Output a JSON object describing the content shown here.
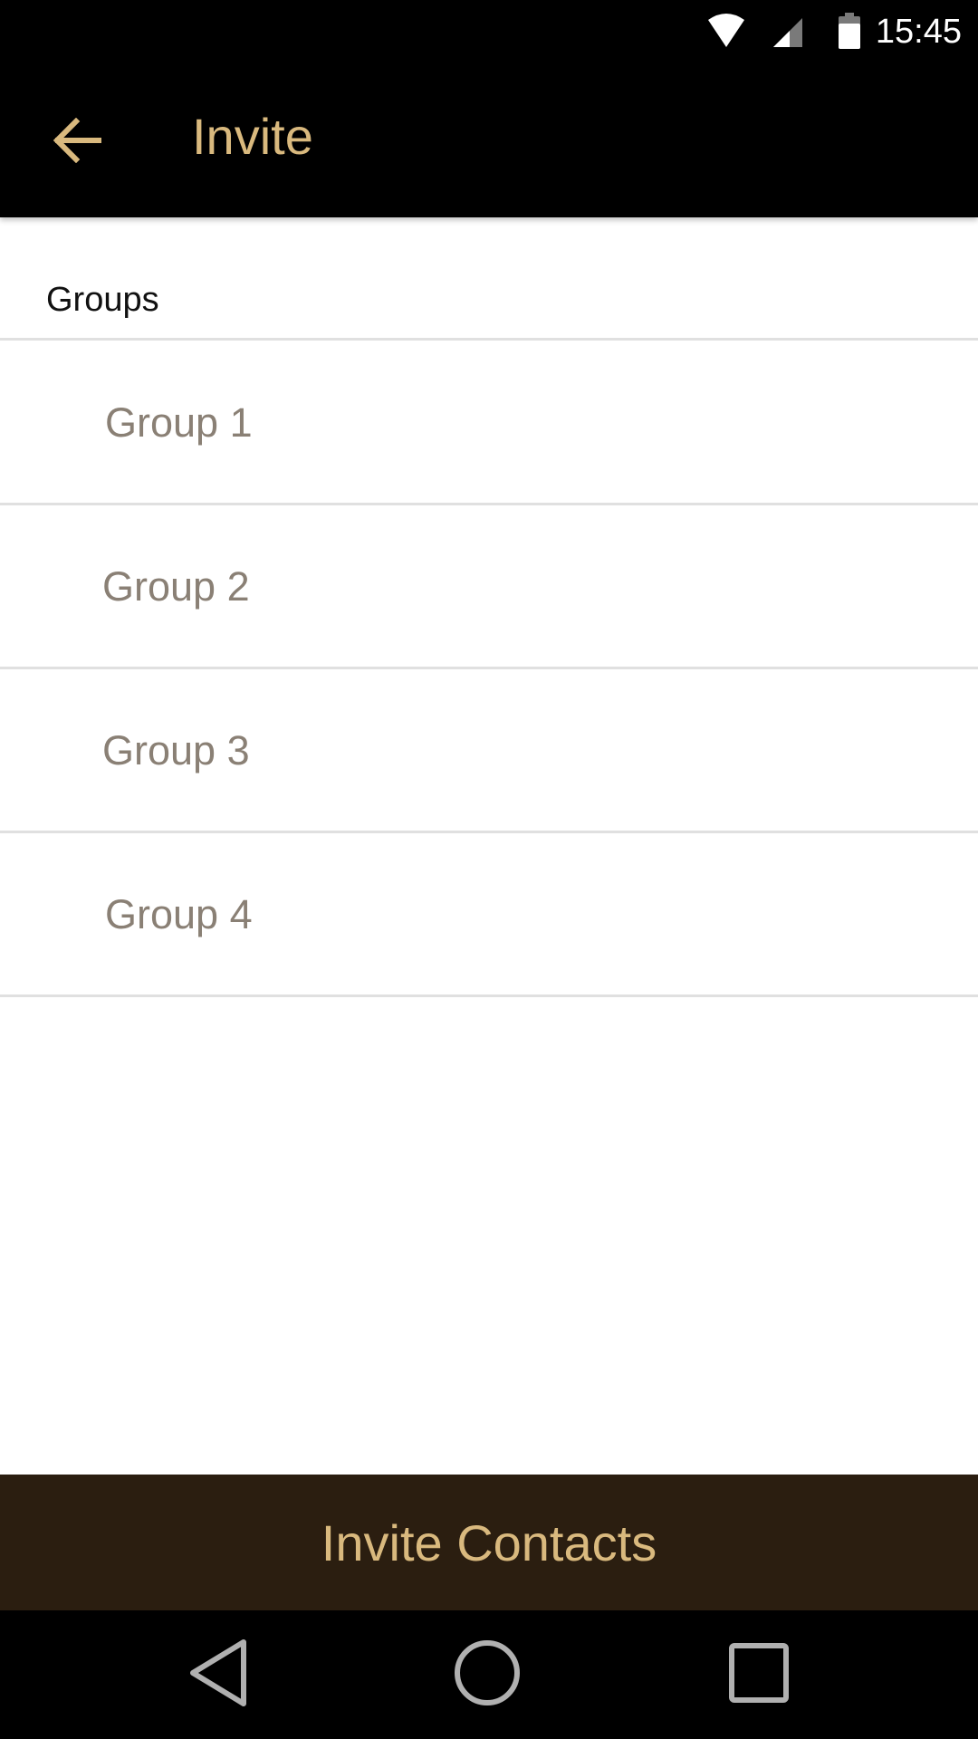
{
  "status_bar": {
    "time": "15:45",
    "icons": [
      "wifi-icon",
      "cell-signal-icon",
      "battery-icon"
    ]
  },
  "app_bar": {
    "title": "Invite",
    "back_icon": "arrow-left-icon"
  },
  "section": {
    "header": "Groups"
  },
  "groups": [
    {
      "label": "Group 1"
    },
    {
      "label": "Group 2"
    },
    {
      "label": "Group 3"
    },
    {
      "label": "Group 4"
    }
  ],
  "invite_button": {
    "label": "Invite Contacts"
  },
  "nav_bar": {
    "icons": [
      "nav-back-icon",
      "nav-home-icon",
      "nav-recents-icon"
    ]
  },
  "colors": {
    "accent": "#d9b97e",
    "app_bar": "#000000",
    "button_bg": "#2b1e10",
    "group_text": "#8a8075",
    "divider": "#e0e0e0"
  }
}
